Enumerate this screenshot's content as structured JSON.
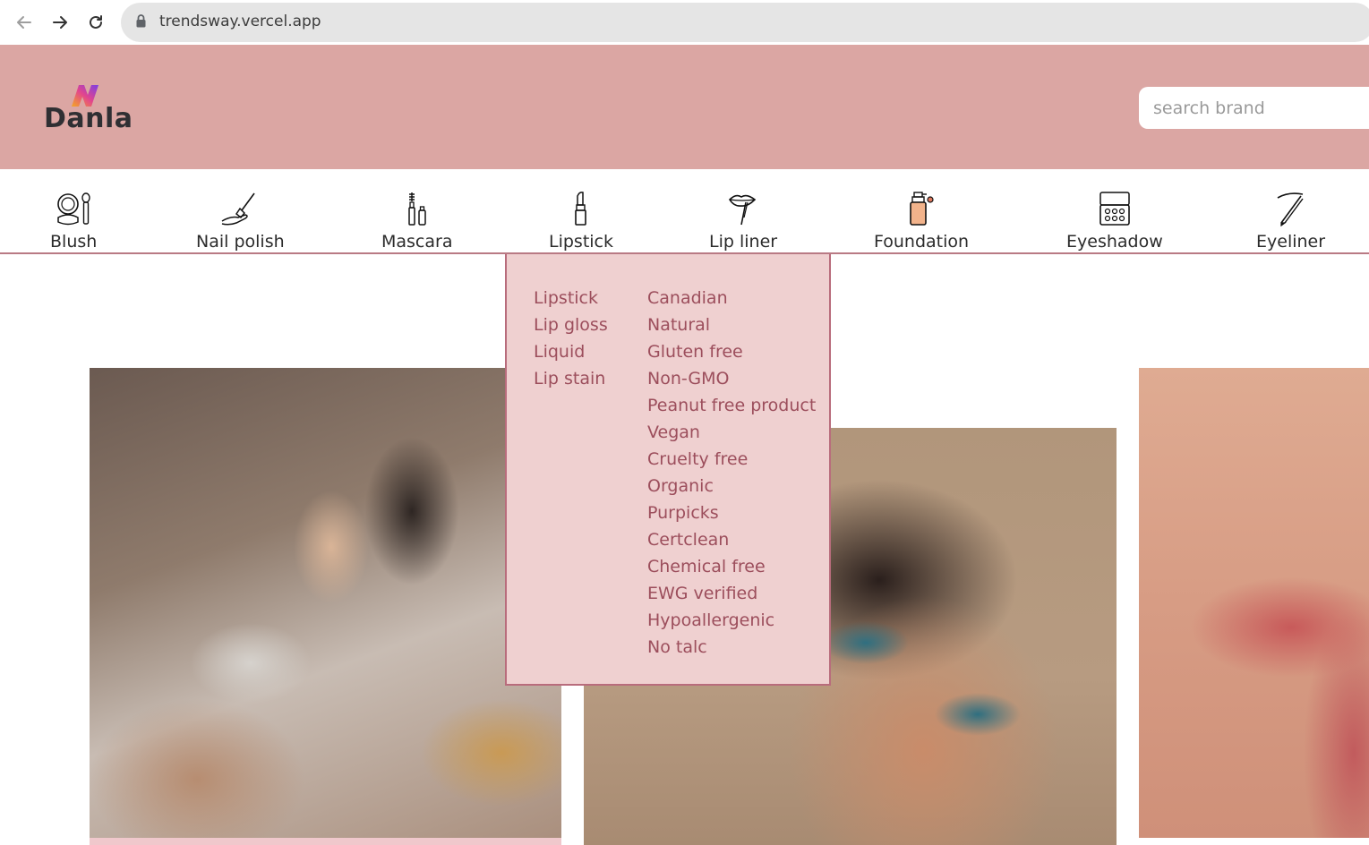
{
  "browser": {
    "url": "trendsway.vercel.app",
    "icons": [
      "back-arrow-icon",
      "forward-arrow-icon",
      "reload-icon",
      "lock-icon"
    ]
  },
  "header": {
    "logo_text": "Danla",
    "search_placeholder": "search brand",
    "background": "#dba6a3"
  },
  "categories": [
    {
      "label": "Blush",
      "icon": "blush-compact-icon"
    },
    {
      "label": "Nail polish",
      "icon": "nail-polish-icon"
    },
    {
      "label": "Mascara",
      "icon": "mascara-icon"
    },
    {
      "label": "Lipstick",
      "icon": "lipstick-icon"
    },
    {
      "label": "Lip liner",
      "icon": "lip-liner-icon"
    },
    {
      "label": "Foundation",
      "icon": "foundation-bottle-icon"
    },
    {
      "label": "Eyeshadow",
      "icon": "eyeshadow-palette-icon"
    },
    {
      "label": "Eyeliner",
      "icon": "eyeliner-icon"
    }
  ],
  "dropdown": {
    "types": [
      "Lipstick",
      "Lip gloss",
      "Liquid",
      "Lip stain"
    ],
    "tags": [
      "Canadian",
      "Natural",
      "Gluten free",
      "Non-GMO",
      "Peanut free product",
      "Vegan",
      "Cruelty free",
      "Organic",
      "Purpicks",
      "Certclean",
      "Chemical free",
      "EWG verified",
      "Hypoallergenic",
      "No talc"
    ],
    "background": "#efd0d0",
    "text_color": "#9c4e5c"
  }
}
